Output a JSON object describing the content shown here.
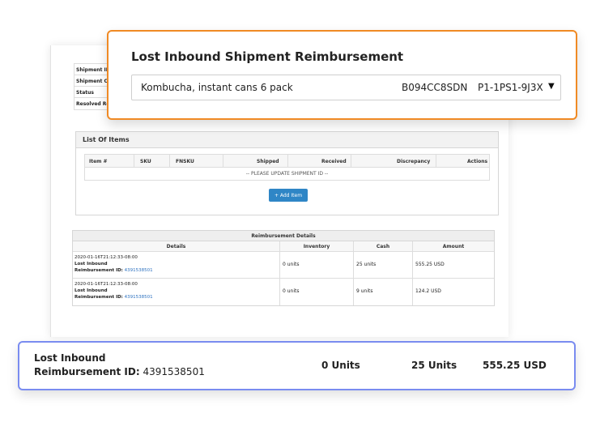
{
  "shipment_info": {
    "labels": [
      "Shipment ID",
      "Shipment Cr",
      "Status",
      "Resolved Re"
    ]
  },
  "list_of_items": {
    "title": "List Of Items",
    "columns": [
      "Item #",
      "SKU",
      "FNSKU",
      "Shipped",
      "Received",
      "Discrepancy",
      "Actions"
    ],
    "empty_message": "-- PLEASE UPDATE SHIPMENT ID --",
    "add_button": "+ Add Item"
  },
  "reimbursement_details": {
    "title": "Reimbursement Details",
    "columns": [
      "Details",
      "Inventory",
      "Cash",
      "Amount"
    ],
    "rows": [
      {
        "date": "2020-01-16T21:12:33-08:00",
        "type": "Lost Inbound",
        "id_label": "Reimbursement ID:",
        "id": "4391538501",
        "inventory": "0 units",
        "cash": "25 units",
        "amount": "555.25 USD"
      },
      {
        "date": "2020-01-16T21:12:33-08:00",
        "type": "Lost Inbound",
        "id_label": "Reimbursement ID:",
        "id": "4391538501",
        "inventory": "0 units",
        "cash": "9 units",
        "amount": "124.2 USD"
      }
    ]
  },
  "top_card": {
    "title": "Lost Inbound Shipment Reimbursement",
    "product_name": "Kombucha, instant cans 6 pack",
    "asin": "B094CC8SDN",
    "sku": "P1-1PS1-9J3X",
    "dropdown_icon": "caret-down-icon"
  },
  "bottom_card": {
    "type": "Lost Inbound",
    "id_label": "Reimbursement ID:",
    "id": "4391538501",
    "inventory": "0 Units",
    "cash": "25 Units",
    "amount": "555.25 USD"
  },
  "colors": {
    "top_card_border": "#f08a24",
    "bottom_card_border": "#7a8cf0",
    "button_blue": "#2f86c6",
    "link_blue": "#2f73c0"
  }
}
